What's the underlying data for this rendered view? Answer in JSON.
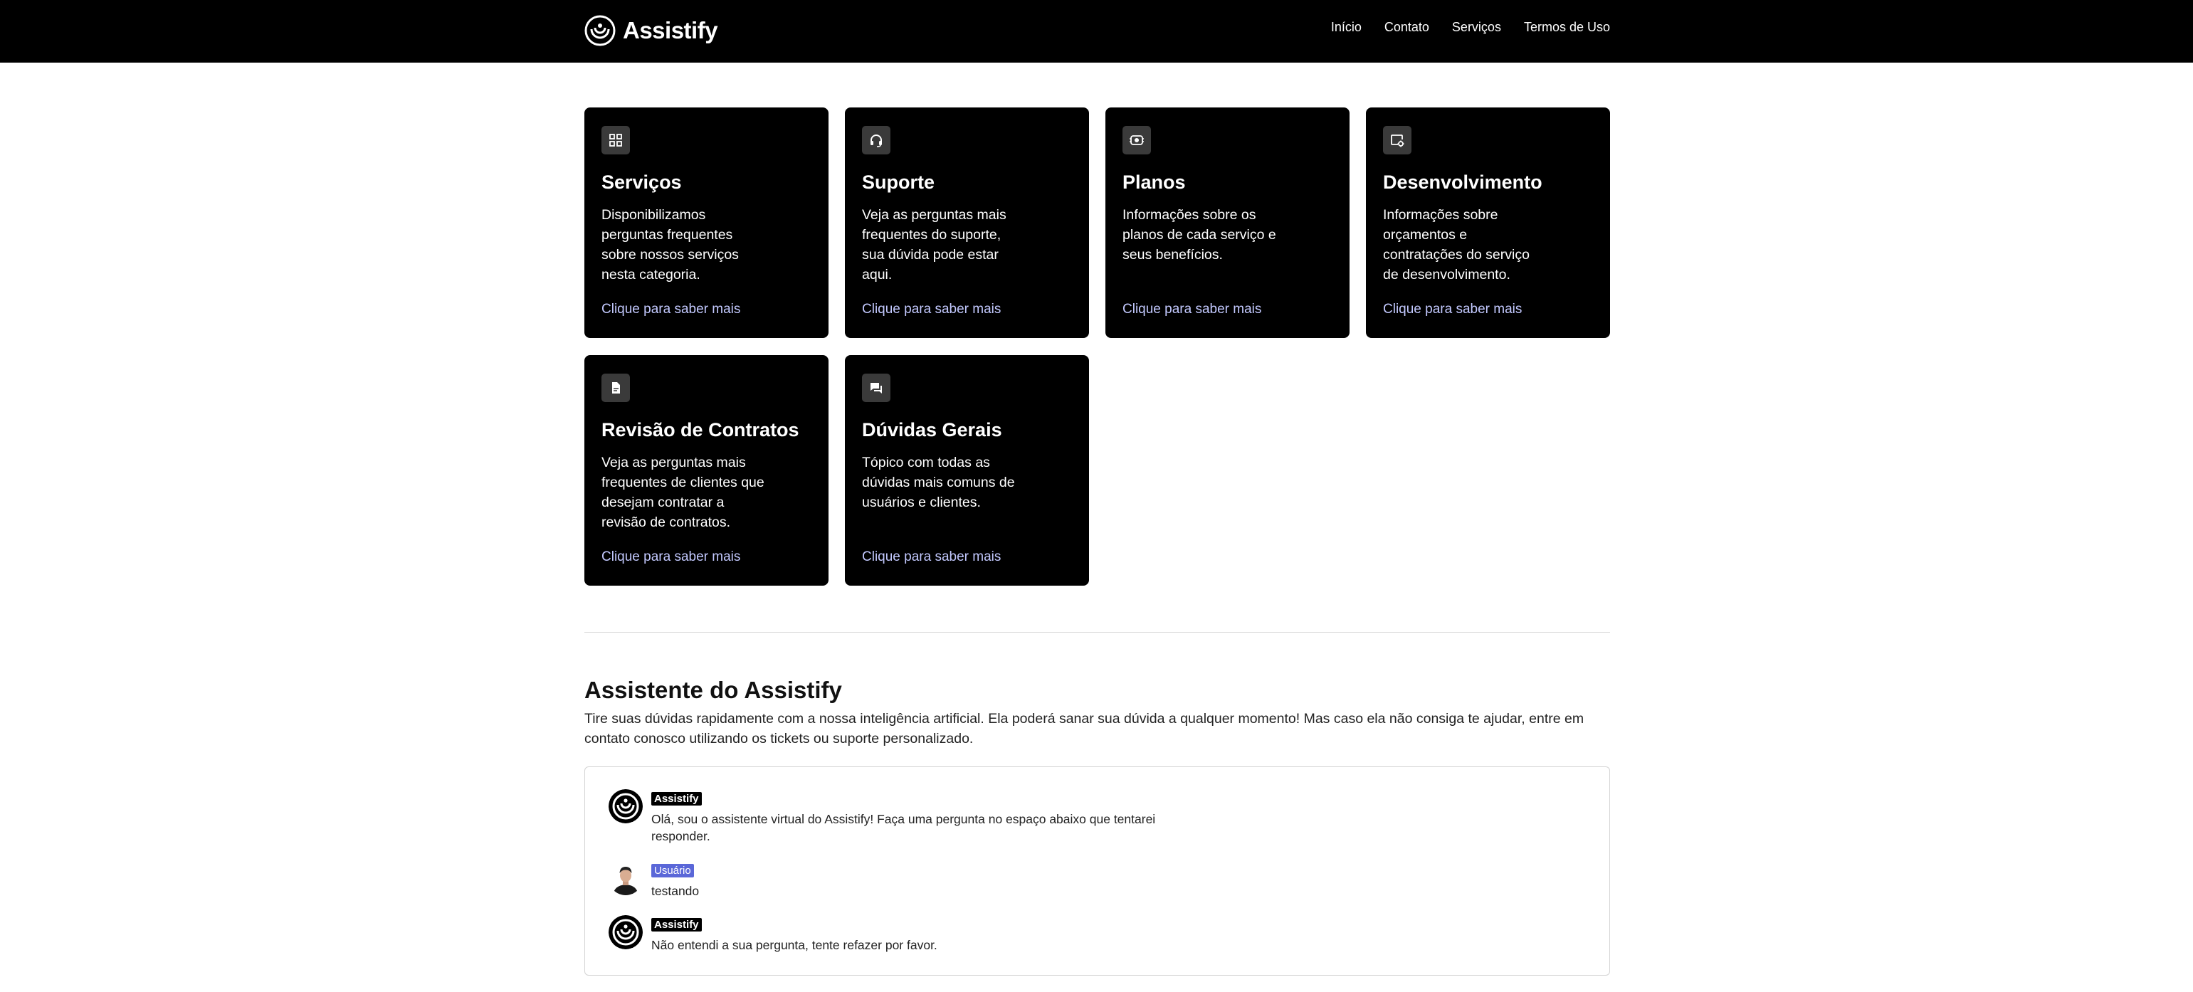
{
  "header": {
    "brand": "Assistify",
    "nav": [
      "Início",
      "Contato",
      "Serviços",
      "Termos de Uso"
    ]
  },
  "cards": [
    {
      "icon": "grid-icon",
      "title": "Serviços",
      "text": "Disponibilizamos perguntas frequentes sobre nossos serviços nesta categoria.",
      "link": "Clique para saber mais"
    },
    {
      "icon": "headset-icon",
      "title": "Suporte",
      "text": "Veja as perguntas mais frequentes do suporte, sua dúvida pode estar aqui.",
      "link": "Clique para saber mais"
    },
    {
      "icon": "plans-icon",
      "title": "Planos",
      "text": "Informações sobre os planos de cada serviço e seus benefícios.",
      "link": "Clique para saber mais"
    },
    {
      "icon": "development-icon",
      "title": "Desenvolvimento",
      "text": "Informações sobre orçamentos e contratações do serviço de desenvolvimento.",
      "link": "Clique para saber mais"
    },
    {
      "icon": "document-icon",
      "title": "Revisão de Contratos",
      "text": "Veja as perguntas mais frequentes de clientes que desejam contratar a revisão de contratos.",
      "link": "Clique para saber mais"
    },
    {
      "icon": "chat-icon",
      "title": "Dúvidas Gerais",
      "text": "Tópico com todas as dúvidas mais comuns de usuários e clientes.",
      "link": "Clique para saber mais"
    }
  ],
  "assistant": {
    "title": "Assistente do Assistify",
    "description": "Tire suas dúvidas rapidamente com a nossa inteligência artificial. Ela poderá sanar sua dúvida a qualquer momento! Mas caso ela não consiga te ajudar, entre em contato conosco utilizando os tickets ou suporte personalizado.",
    "messages": [
      {
        "sender": "Assistify",
        "role": "bot",
        "text": "Olá, sou o assistente virtual do Assistify! Faça uma pergunta no espaço abaixo que tentarei responder."
      },
      {
        "sender": "Usuário",
        "role": "user",
        "text": "testando"
      },
      {
        "sender": "Assistify",
        "role": "bot",
        "text": "Não entendi a sua pergunta, tente refazer por favor."
      }
    ]
  },
  "colors": {
    "header_bg": "#000000",
    "card_bg": "#000000",
    "link": "#c3c9ff",
    "user_badge": "#5a67d8"
  }
}
